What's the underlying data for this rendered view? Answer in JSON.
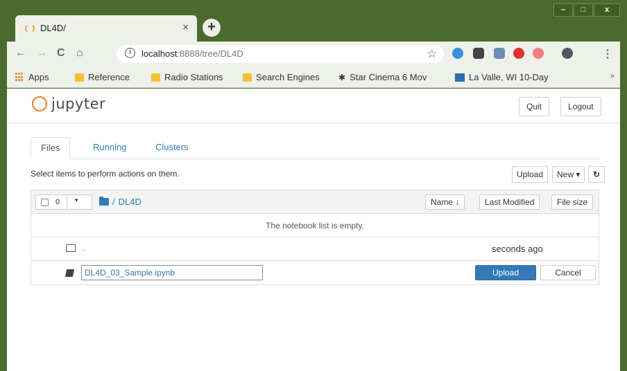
{
  "browser": {
    "tab_title": "DL4D/",
    "tab_close": "×",
    "new_tab": "+",
    "url_host": "localhost",
    "url_path": ":8888/tree/DL4D",
    "info": "i",
    "star": "☆",
    "menu": "⋮",
    "win_min": "–",
    "win_max": "□",
    "win_close": "x",
    "nav_back": "←",
    "nav_forward": "→",
    "nav_reload": "C",
    "nav_home": "⌂"
  },
  "bookmarks": {
    "apps": "Apps",
    "items": [
      "Reference",
      "Radio Stations",
      "Search Engines",
      "Star Cinema 6 Mov",
      "La Valle, WI 10-Day"
    ],
    "more": "»"
  },
  "jupyter": {
    "logo": "jupyter",
    "quit": "Quit",
    "logout": "Logout",
    "tabs": [
      "Files",
      "Running",
      "Clusters"
    ],
    "hint": "Select items to perform actions on them.",
    "upload": "Upload",
    "new": "New ▾",
    "refresh": "↻",
    "selected_count": "0",
    "caret": "▾",
    "breadcrumb_sep": "/",
    "breadcrumb_dir": "DL4D",
    "sort_name": "Name ↓",
    "sort_modified": "Last Modified",
    "sort_size": "File size",
    "empty_msg": "The notebook list is empty.",
    "parent_name": "..",
    "parent_modified": "seconds ago",
    "upload_filename": "DL4D_03_Sample.ipynb",
    "upload_btn": "Upload",
    "cancel_btn": "Cancel"
  },
  "colors": {
    "frame": "#4a6b2e",
    "link": "#337ab7",
    "logo_orange": "#f37626"
  }
}
